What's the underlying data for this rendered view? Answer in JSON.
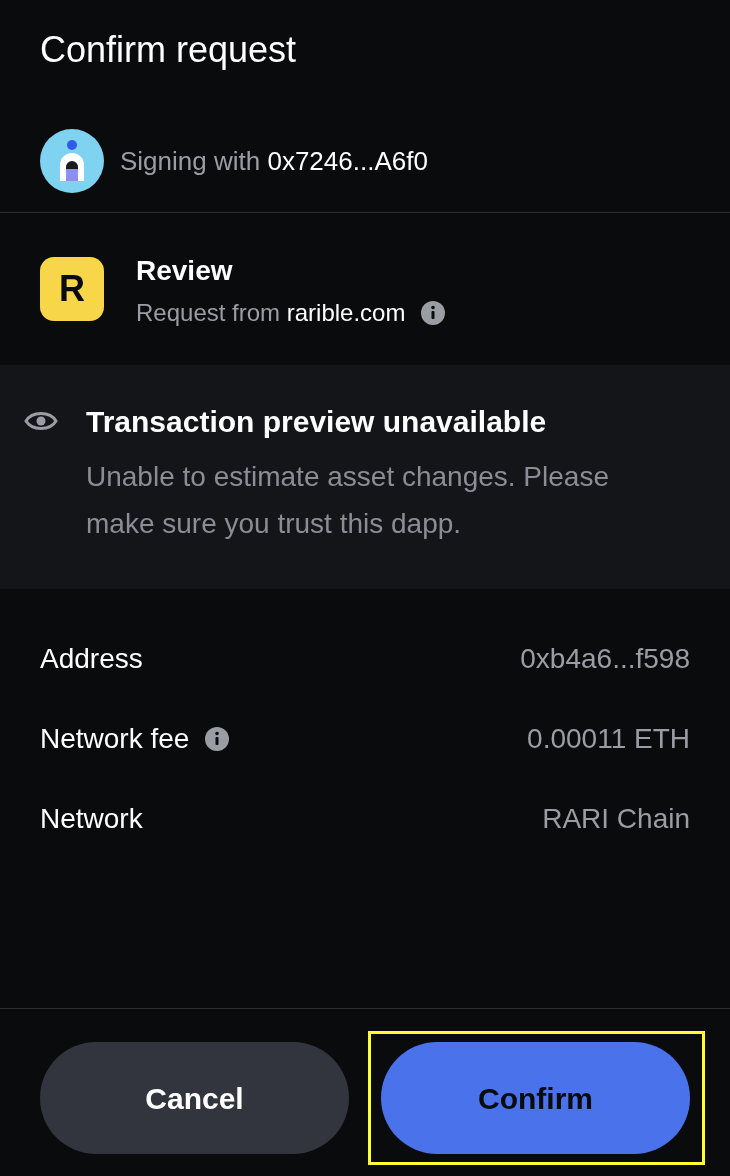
{
  "title": "Confirm request",
  "account": {
    "prefix": "Signing with",
    "address": "0x7246...A6f0"
  },
  "request": {
    "title": "Review",
    "prefix": "Request from",
    "site": "rarible.com",
    "logo_letter": "R"
  },
  "preview": {
    "title": "Transaction preview unavailable",
    "message": "Unable to estimate asset changes. Please make sure you trust this dapp."
  },
  "details": [
    {
      "label": "Address",
      "value": "0xb4a6...f598",
      "info": false
    },
    {
      "label": "Network fee",
      "value": "0.00011 ETH",
      "info": true
    },
    {
      "label": "Network",
      "value": "RARI Chain",
      "info": false
    }
  ],
  "buttons": [
    {
      "label": "Cancel",
      "kind": "secondary",
      "highlighted": false
    },
    {
      "label": "Confirm",
      "kind": "primary",
      "highlighted": true
    }
  ]
}
